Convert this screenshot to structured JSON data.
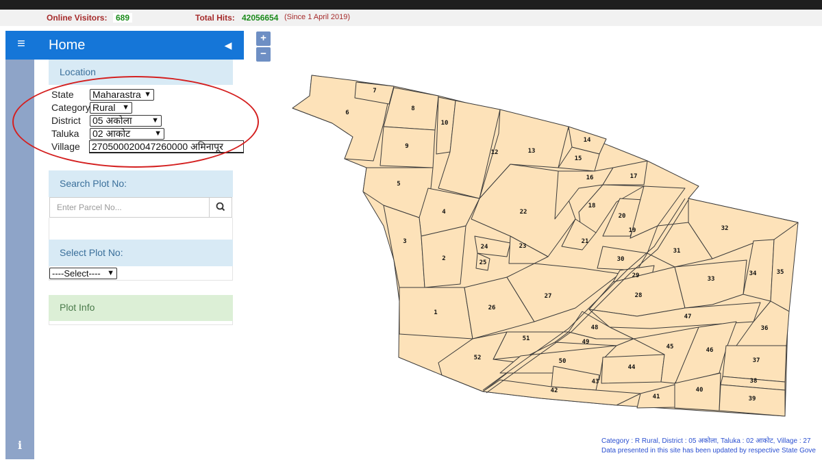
{
  "stats": {
    "visitors_label": "Online Visitors:",
    "visitors_value": "689",
    "hits_label": "Total Hits:",
    "hits_value": "42056654",
    "since_note": "(Since 1 April 2019)"
  },
  "sidebar": {
    "title": "Home",
    "location": {
      "heading": "Location",
      "state_label": "State",
      "state_value": "Maharastra",
      "category_label": "Category",
      "category_value": "Rural",
      "district_label": "District",
      "district_value": "05 अकोला",
      "taluka_label": "Taluka",
      "taluka_value": "02 आकोट",
      "village_label": "Village",
      "village_value": "270500020047260000 अमिनापूर"
    },
    "search": {
      "heading": "Search Plot No:",
      "placeholder": "Enter Parcel No..."
    },
    "select_plot": {
      "heading": "Select Plot No:",
      "value": "----Select----"
    },
    "plot_info": {
      "heading": "Plot Info"
    }
  },
  "zoom": {
    "in": "+",
    "out": "−"
  },
  "map": {
    "parcel_fill": "#fde2b9",
    "parcel_stroke": "#3a3a3a",
    "labels": [
      "1",
      "2",
      "3",
      "4",
      "5",
      "6",
      "7",
      "8",
      "9",
      "10",
      "12",
      "13",
      "14",
      "15",
      "16",
      "17",
      "18",
      "19",
      "20",
      "21",
      "22",
      "23",
      "24",
      "25",
      "26",
      "27",
      "28",
      "29",
      "30",
      "31",
      "32",
      "33",
      "34",
      "35",
      "36",
      "37",
      "38",
      "39",
      "40",
      "41",
      "42",
      "43",
      "44",
      "45",
      "46",
      "47",
      "48",
      "49",
      "50",
      "51",
      "52"
    ]
  },
  "footer": {
    "line1": "Category : R Rural, District : 05 अकोला, Taluka : 02 आकोट, Village : 27",
    "line2": "Data presented in this site has been updated by respective State Gove"
  },
  "colors": {
    "header_blue": "#1576d8",
    "strip": "#8ea4c8",
    "panel_head_bg": "#d8eaf5",
    "plot_info_bg": "#dcefd6",
    "annotation_red": "#d42020"
  }
}
